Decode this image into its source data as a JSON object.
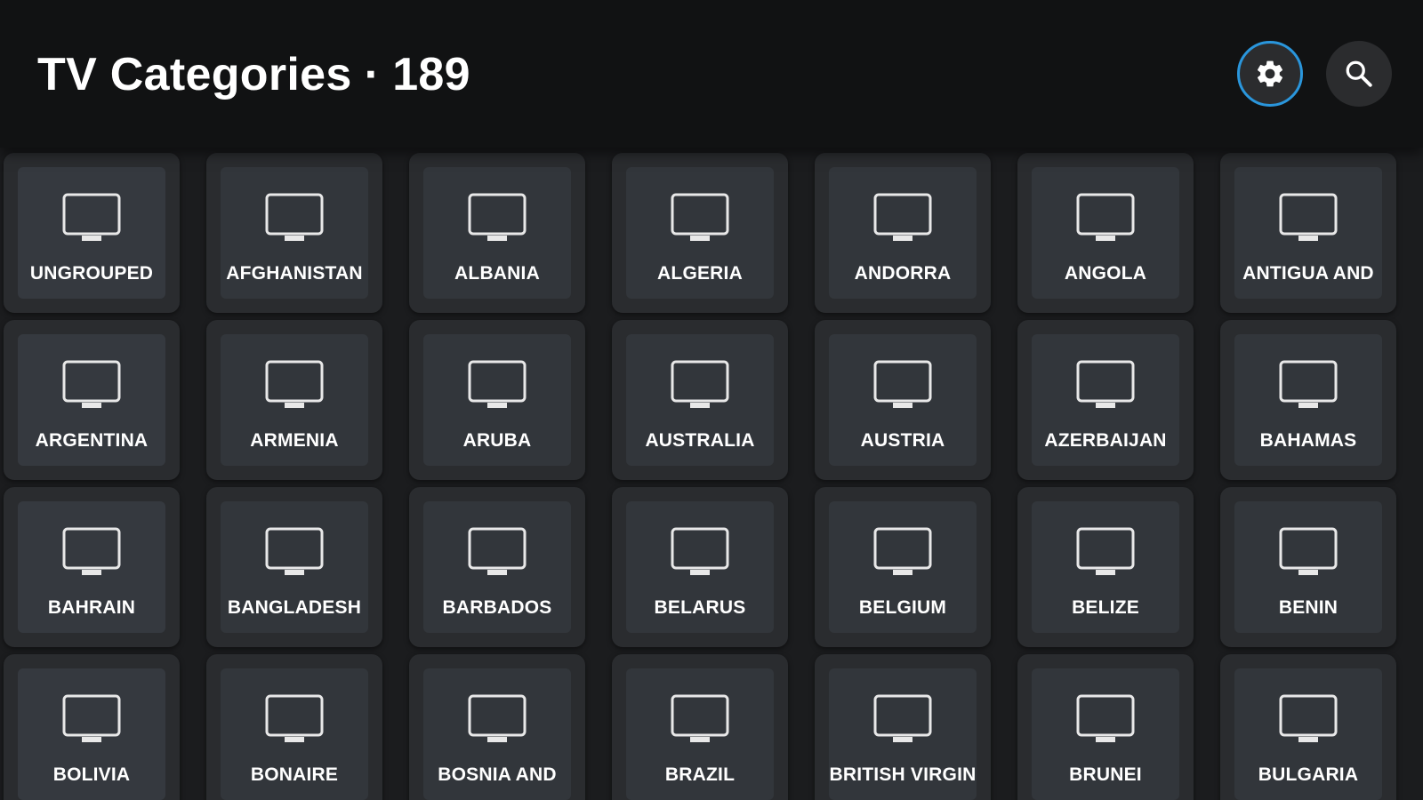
{
  "header": {
    "title": "TV Categories",
    "separator": "·",
    "count": "189",
    "settings_icon": "gear-icon",
    "search_icon": "search-icon",
    "accent_color": "#2a96dc"
  },
  "tile_icon": "tv-icon",
  "categories": [
    "UNGROUPED",
    "AFGHANISTAN",
    "ALBANIA",
    "ALGERIA",
    "ANDORRA",
    "ANGOLA",
    "ANTIGUA AND",
    "ARGENTINA",
    "ARMENIA",
    "ARUBA",
    "AUSTRALIA",
    "AUSTRIA",
    "AZERBAIJAN",
    "BAHAMAS",
    "BAHRAIN",
    "BANGLADESH",
    "BARBADOS",
    "BELARUS",
    "BELGIUM",
    "BELIZE",
    "BENIN",
    "BOLIVIA",
    "BONAIRE",
    "BOSNIA AND",
    "BRAZIL",
    "BRITISH VIRGIN",
    "BRUNEI",
    "BULGARIA"
  ]
}
